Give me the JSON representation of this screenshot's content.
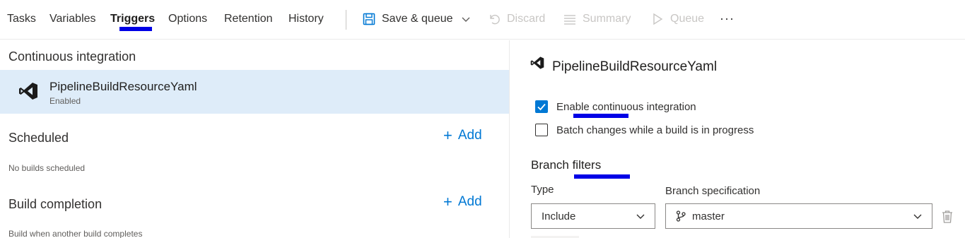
{
  "tabs": [
    {
      "label": "Tasks"
    },
    {
      "label": "Variables"
    },
    {
      "label": "Triggers"
    },
    {
      "label": "Options"
    },
    {
      "label": "Retention"
    },
    {
      "label": "History"
    }
  ],
  "toolbar": {
    "save_queue": "Save & queue",
    "discard": "Discard",
    "summary": "Summary",
    "queue": "Queue",
    "more": "···"
  },
  "left": {
    "ci_title": "Continuous integration",
    "ci_item_name": "PipelineBuildResourceYaml",
    "ci_item_status": "Enabled",
    "scheduled_title": "Scheduled",
    "scheduled_empty": "No builds scheduled",
    "build_completion_title": "Build completion",
    "build_completion_empty": "Build when another build completes",
    "add_label": "Add"
  },
  "right": {
    "title": "PipelineBuildResourceYaml",
    "enable_ci_label": "Enable continuous integration",
    "enable_ci_checked": true,
    "batch_label": "Batch changes while a build is in progress",
    "batch_checked": false,
    "branch_filters_title": "Branch filters",
    "type_label": "Type",
    "type_value": "Include",
    "branch_spec_label": "Branch specification",
    "branch_spec_value": "master"
  },
  "colors": {
    "accent": "#0078d4",
    "selected_bg": "#deecf9",
    "annotation_underline": "#0000e6",
    "disabled_text": "#c8c6c4"
  }
}
